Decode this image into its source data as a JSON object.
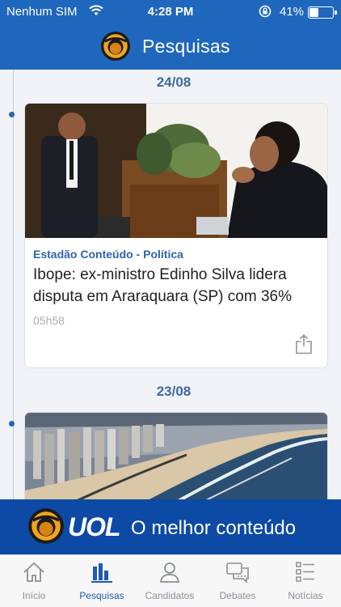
{
  "status_bar": {
    "carrier": "Nenhum SIM",
    "time": "4:28 PM",
    "battery_pct": "41%",
    "battery_level": 0.41
  },
  "header": {
    "title": "Pesquisas"
  },
  "feed": [
    {
      "date": "24/08",
      "source": "Estadão Conteúdo - Política",
      "title": "Ibope: ex-ministro Edinho Silva lidera disputa em Araraquara (SP) com 36%",
      "time": "05h58"
    },
    {
      "date": "23/08"
    }
  ],
  "banner": {
    "brand": "UOL",
    "tagline": "O melhor conteúdo"
  },
  "tabs": [
    {
      "label": "Início",
      "icon": "home-icon"
    },
    {
      "label": "Pesquisas",
      "icon": "bar-chart-icon"
    },
    {
      "label": "Candidatos",
      "icon": "person-icon"
    },
    {
      "label": "Debates",
      "icon": "chat-icon"
    },
    {
      "label": "Notícias",
      "icon": "news-list-icon"
    }
  ],
  "active_tab": "Pesquisas",
  "colors": {
    "header_blue": "#1f67bd",
    "banner_blue": "#0c4aa6",
    "date_blue": "#3e6aa4",
    "source_blue": "#2e64ab",
    "logo_orange": "#f2a51c"
  }
}
